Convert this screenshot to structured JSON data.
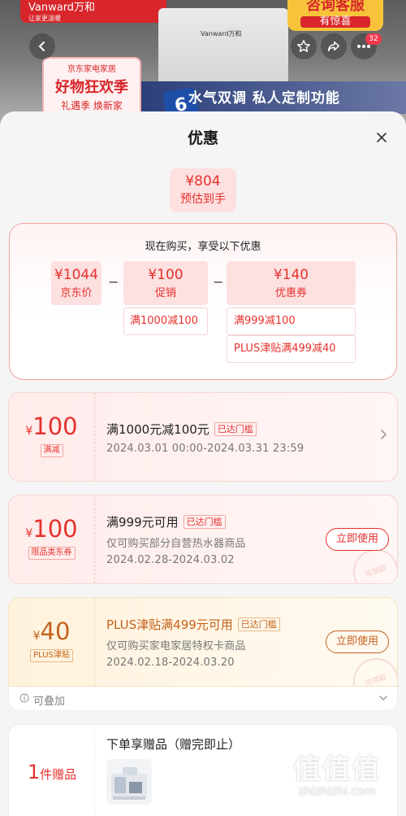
{
  "background": {
    "brand_name": "Vanward万和",
    "brand_slogan": "让家更温暖",
    "service_title": "咨询客服",
    "service_sub": "有惊喜",
    "device_brand": "Vanward万和",
    "promo_store": "京东家电家居",
    "promo_title": "好物狂欢季",
    "promo_sub": "礼遇季 焕新家",
    "feature_text": "水气双调 私人定制功能",
    "feature_badge": "6",
    "more_badge_count": "32"
  },
  "sheet": {
    "title": "优惠"
  },
  "estimate": {
    "value": "¥804",
    "label": "预估到手"
  },
  "calc": {
    "title": "现在购买，享受以下优惠",
    "jd_price": {
      "value": "¥1044",
      "label": "京东价"
    },
    "promo": {
      "value": "¥100",
      "label": "促销",
      "detail": "满1000减100"
    },
    "coupon": {
      "value": "¥140",
      "label": "优惠券",
      "details": [
        "满999减100",
        "PLUS津贴满499减40"
      ]
    },
    "minus": "−"
  },
  "coupons": [
    {
      "currency": "¥",
      "amount": "100",
      "tag": "满减",
      "title": "满1000元减100元",
      "threshold": "已达门槛",
      "lines": [
        "2024.03.01 00:00-2024.03.31 23:59"
      ]
    },
    {
      "currency": "¥",
      "amount": "100",
      "tag": "限品类东券",
      "title": "满999元可用",
      "threshold": "已达门槛",
      "lines": [
        "仅可购买部分自营热水器商品",
        "2024.02.28-2024.03.02"
      ],
      "action": "立即使用",
      "stamp": "可领取"
    },
    {
      "currency": "¥",
      "amount": "40",
      "tag": "PLUS津贴",
      "title": "PLUS津贴满499元可用",
      "threshold": "已达门槛",
      "lines": [
        "仅可购买家电家居特权卡商品",
        "2024.02.18-2024.03.20"
      ],
      "action": "立即使用",
      "stamp": "可领取",
      "stack_label": "可叠加"
    }
  ],
  "gift": {
    "count": "1",
    "unit": "件赠品",
    "title": "下单享赠品（赠完即止）"
  },
  "watermark": {
    "logo": "值值值",
    "url": "zhizhizhi.com"
  },
  "colors": {
    "accent_red": "#e5322d",
    "accent_gold": "#c4621a",
    "chip_bg": "#fde0e0"
  }
}
